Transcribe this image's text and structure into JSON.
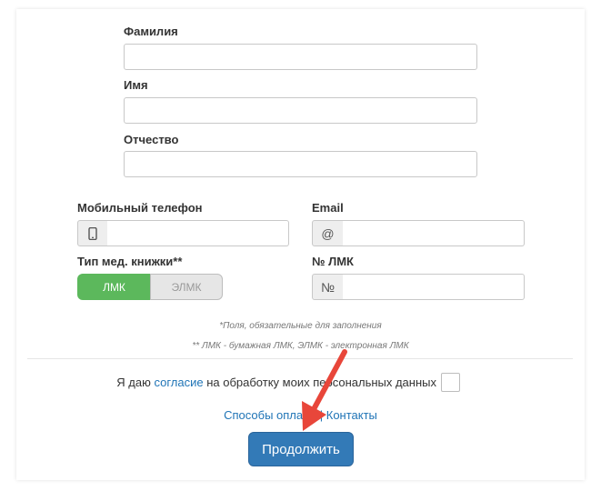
{
  "form": {
    "last_name": {
      "label": "Фамилия",
      "value": ""
    },
    "first_name": {
      "label": "Имя",
      "value": ""
    },
    "middle_name": {
      "label": "Отчество",
      "value": ""
    },
    "phone": {
      "label": "Мобильный телефон",
      "value": ""
    },
    "email": {
      "label": "Email",
      "addon": "@",
      "value": ""
    },
    "book_type": {
      "label": "Тип мед. книжки**",
      "options": [
        "ЛМК",
        "ЭЛМК"
      ],
      "selected": "ЛМК"
    },
    "lmk_number": {
      "label": "№ ЛМК",
      "addon": "№",
      "value": ""
    }
  },
  "notes": {
    "required": "*Поля, обязательные для заполнения",
    "types": "** ЛМК - бумажная ЛМК, ЭЛМК - электронная ЛМК"
  },
  "consent": {
    "prefix": "Я даю ",
    "link": "согласие",
    "suffix": " на обработку моих персональных данных",
    "checked": false
  },
  "links": {
    "payment": "Способы оплаты",
    "separator": " | ",
    "contacts": "Контакты"
  },
  "submit_label": "Продолжить",
  "colors": {
    "accent": "#337ab7",
    "toggle_active": "#5cb85c",
    "link": "#1f74b6",
    "arrow": "#e8463a"
  }
}
